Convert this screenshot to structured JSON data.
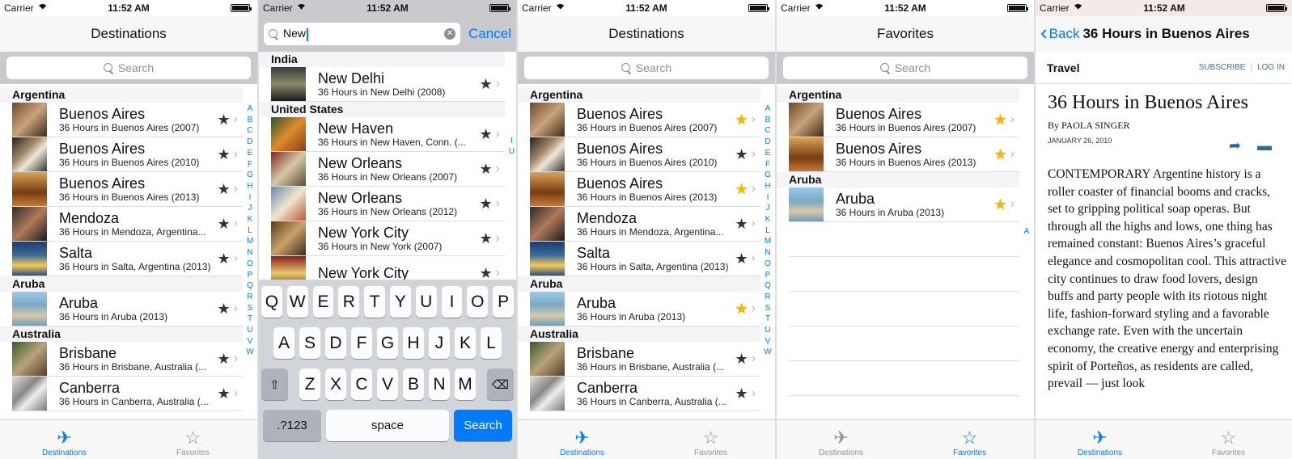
{
  "status": {
    "carrier": "Carrier",
    "time": "11:52 AM"
  },
  "tabs": [
    {
      "label": "Destinations",
      "icon": "airplane-icon"
    },
    {
      "label": "Favorites",
      "icon": "star-icon"
    }
  ],
  "index_letters": [
    "A",
    "B",
    "C",
    "D",
    "E",
    "F",
    "G",
    "H",
    "I",
    "J",
    "K",
    "L",
    "M",
    "N",
    "O",
    "P",
    "Q",
    "R",
    "S",
    "T",
    "U",
    "V",
    "W"
  ],
  "screen1": {
    "title": "Destinations",
    "search_placeholder": "Search",
    "sections": [
      {
        "name": "Argentina",
        "rows": [
          {
            "title": "Buenos Aires",
            "sub": "36 Hours in Buenos Aires (2007)"
          },
          {
            "title": "Buenos Aires",
            "sub": "36 Hours in Buenos Aires (2010)"
          },
          {
            "title": "Buenos Aires",
            "sub": "36 Hours in Buenos Aires (2013)"
          },
          {
            "title": "Mendoza",
            "sub": "36 Hours in Mendoza, Argentina..."
          },
          {
            "title": "Salta",
            "sub": "36 Hours in Salta, Argentina (2013)"
          }
        ]
      },
      {
        "name": "Aruba",
        "rows": [
          {
            "title": "Aruba",
            "sub": "36 Hours in Aruba (2013)"
          }
        ]
      },
      {
        "name": "Australia",
        "rows": [
          {
            "title": "Brisbane",
            "sub": "36 Hours in Brisbane, Australia (..."
          },
          {
            "title": "Canberra",
            "sub": "36 Hours in Canberra, Australia (..."
          }
        ]
      }
    ]
  },
  "screen2": {
    "search_value": "New",
    "cancel": "Cancel",
    "index": [
      "I",
      "U"
    ],
    "sections": [
      {
        "name": "India",
        "rows": [
          {
            "title": "New Delhi",
            "sub": "36 Hours in New Delhi (2008)"
          }
        ]
      },
      {
        "name": "United States",
        "rows": [
          {
            "title": "New Haven",
            "sub": "36 Hours in New Haven, Conn. (..."
          },
          {
            "title": "New Orleans",
            "sub": "36 Hours in New Orleans (2007)"
          },
          {
            "title": "New Orleans",
            "sub": "36 Hours in New Orleans (2012)"
          },
          {
            "title": "New York City",
            "sub": "36 Hours in New York (2007)"
          },
          {
            "title": "New York City",
            "sub": ""
          }
        ]
      }
    ],
    "keyboard": {
      "row1": [
        "Q",
        "W",
        "E",
        "R",
        "T",
        "Y",
        "U",
        "I",
        "O",
        "P"
      ],
      "row2": [
        "A",
        "S",
        "D",
        "F",
        "G",
        "H",
        "J",
        "K",
        "L"
      ],
      "row3": [
        "Z",
        "X",
        "C",
        "V",
        "B",
        "N",
        "M"
      ],
      "numbers": ".?123",
      "space": "space",
      "search": "Search"
    }
  },
  "screen3": {
    "title": "Destinations",
    "search_placeholder": "Search",
    "sections": [
      {
        "name": "Argentina",
        "rows": [
          {
            "title": "Buenos Aires",
            "sub": "36 Hours in Buenos Aires (2007)",
            "fav": true
          },
          {
            "title": "Buenos Aires",
            "sub": "36 Hours in Buenos Aires (2010)",
            "fav": false
          },
          {
            "title": "Buenos Aires",
            "sub": "36 Hours in Buenos Aires (2013)",
            "fav": true
          },
          {
            "title": "Mendoza",
            "sub": "36 Hours in Mendoza, Argentina...",
            "fav": false
          },
          {
            "title": "Salta",
            "sub": "36 Hours in Salta, Argentina (2013)",
            "fav": false
          }
        ]
      },
      {
        "name": "Aruba",
        "rows": [
          {
            "title": "Aruba",
            "sub": "36 Hours in Aruba (2013)",
            "fav": true
          }
        ]
      },
      {
        "name": "Australia",
        "rows": [
          {
            "title": "Brisbane",
            "sub": "36 Hours in Brisbane, Australia (...",
            "fav": false
          },
          {
            "title": "Canberra",
            "sub": "36 Hours in Canberra, Australia (...",
            "fav": false
          }
        ]
      }
    ]
  },
  "screen4": {
    "title": "Favorites",
    "search_placeholder": "Search",
    "index": [
      "A"
    ],
    "sections": [
      {
        "name": "Argentina",
        "rows": [
          {
            "title": "Buenos Aires",
            "sub": "36 Hours in Buenos Aires (2007)"
          },
          {
            "title": "Buenos Aires",
            "sub": "36 Hours in Buenos Aires (2013)"
          }
        ]
      },
      {
        "name": "Aruba",
        "rows": [
          {
            "title": "Aruba",
            "sub": "36 Hours in Aruba (2013)"
          }
        ]
      }
    ]
  },
  "screen5": {
    "back": "Back",
    "title": "36 Hours in Buenos Aires",
    "section": "Travel",
    "subscribe": "SUBSCRIBE",
    "login": "LOG IN",
    "headline": "36 Hours in Buenos Aires",
    "byline": "By PAOLA SINGER",
    "date": "JANUARY 26, 2010",
    "body": "CONTEMPORARY Argentine history is a roller coaster of financial booms and cracks, set to gripping political soap operas. But through all the highs and lows, one thing has remained constant: Buenos Aires’s graceful elegance and cosmopolitan cool. This attractive city continues to draw food lovers, design buffs and party people with its riotous night life, fashion-forward styling and a favorable exchange rate. Even with the uncertain economy, the creative energy and enterprising spirit of Porteños, as residents are called, prevail — just look"
  },
  "colors": {
    "accent": "#007aff",
    "favorite_star": "#f5b800"
  }
}
